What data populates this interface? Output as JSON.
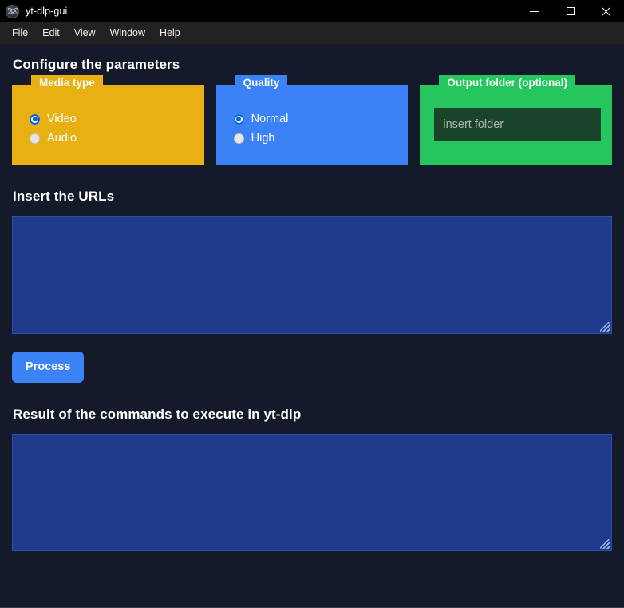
{
  "window": {
    "title": "yt-dlp-gui",
    "icon": "electron-app-icon",
    "controls": {
      "minimize": "minimize-icon",
      "maximize": "maximize-icon",
      "close": "close-icon"
    }
  },
  "menubar": {
    "items": [
      {
        "label": "File"
      },
      {
        "label": "Edit"
      },
      {
        "label": "View"
      },
      {
        "label": "Window"
      },
      {
        "label": "Help"
      }
    ]
  },
  "main": {
    "configure_heading": "Configure the parameters",
    "urls_heading": "Insert the URLs",
    "result_heading": "Result of the commands to execute in yt-dlp",
    "process_button": "Process"
  },
  "cards": {
    "media_type": {
      "legend": "Media type",
      "color": "#e8b012",
      "options": [
        {
          "label": "Video",
          "selected": true
        },
        {
          "label": "Audio",
          "selected": false
        }
      ]
    },
    "quality": {
      "legend": "Quality",
      "color": "#3b82f6",
      "options": [
        {
          "label": "Normal",
          "selected": true
        },
        {
          "label": "High",
          "selected": false
        }
      ]
    },
    "output_folder": {
      "legend": "Output folder (optional)",
      "color": "#26c65f",
      "input": {
        "value": "",
        "placeholder": "insert folder"
      }
    }
  },
  "urls_textarea": {
    "value": "",
    "placeholder": ""
  },
  "result_textarea": {
    "value": "",
    "placeholder": ""
  },
  "colors": {
    "titlebar": "#000000",
    "menubar": "#222222",
    "body": "#141a29",
    "accent_blue": "#3b82f6",
    "accent_yellow": "#e8b012",
    "accent_green": "#26c65f",
    "textarea_blue": "#1f3c8c",
    "folder_input_green": "#1a4429"
  }
}
